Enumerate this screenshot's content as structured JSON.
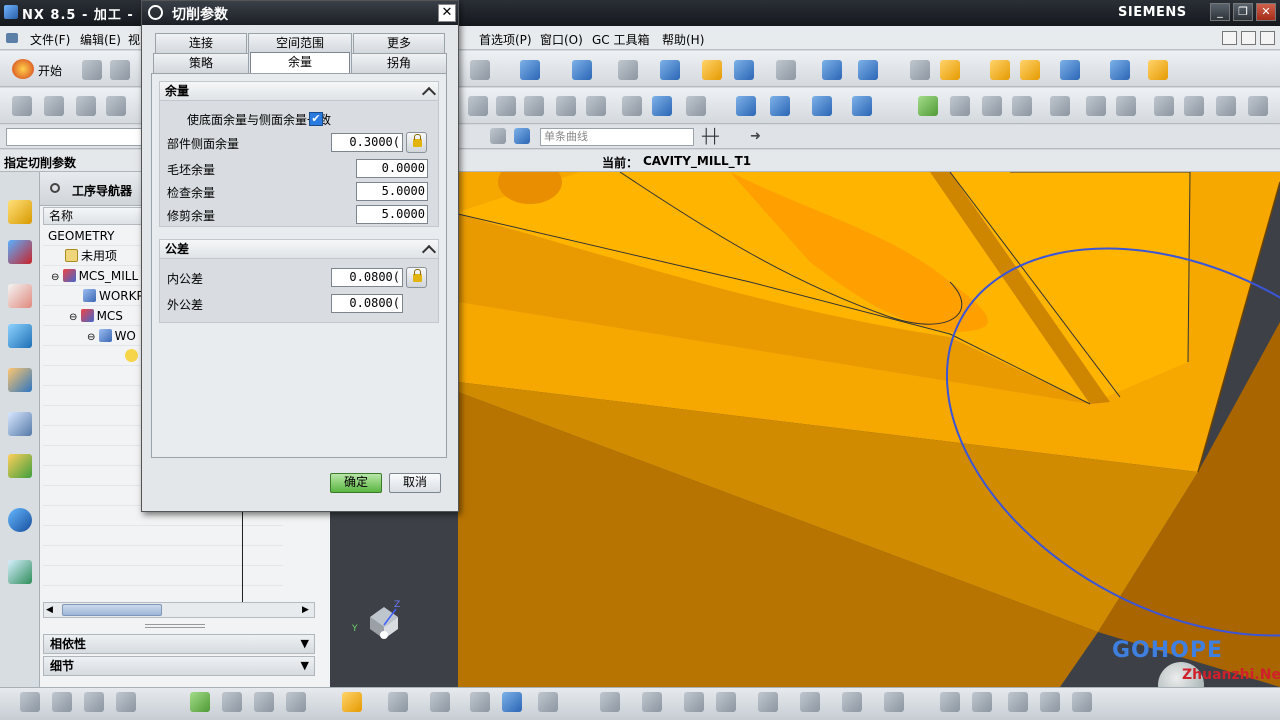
{
  "app": {
    "title": "NX 8.5 - 加工 -",
    "brand": "SIEMENS",
    "min": "_",
    "max": "❐",
    "close": "✕"
  },
  "menu": {
    "start_label": "开始",
    "items": [
      "文件(F)",
      "编辑(E)",
      "视",
      "首选项(P)",
      "窗口(O)",
      "GC 工具箱",
      "帮助(H)"
    ]
  },
  "selection_bar": {
    "filter_placeholder": "",
    "curve_rule": "单条曲线"
  },
  "cue": {
    "prompt": "指定切削参数",
    "current_label": "当前：",
    "current_op": "CAVITY_MILL_T1"
  },
  "navigator": {
    "title": "工序导航器",
    "column": "名称",
    "rows": [
      "GEOMETRY",
      "未用项",
      "MCS_MILL",
      "WORKP",
      "MCS",
      "WO"
    ],
    "sections": [
      "相依性",
      "细节"
    ]
  },
  "dialog": {
    "title": "切削参数",
    "tabs_top": [
      "连接",
      "空间范围",
      "更多"
    ],
    "tabs_bottom": [
      "策略",
      "余量",
      "拐角"
    ],
    "active_tab": "余量",
    "stock": {
      "heading": "余量",
      "checkbox_label": "使底面余量与侧面余量一致",
      "checked": true,
      "part_side_label": "部件侧面余量",
      "part_side_value": "0.3000(",
      "blank_label": "毛坯余量",
      "blank_value": "0.0000",
      "check_label": "检查余量",
      "check_value": "5.0000",
      "trim_label": "修剪余量",
      "trim_value": "5.0000"
    },
    "tolerance": {
      "heading": "公差",
      "intol_label": "内公差",
      "intol_value": "0.0800(",
      "outtol_label": "外公差",
      "outtol_value": "0.0800("
    },
    "ok": "确定",
    "cancel": "取消"
  },
  "watermark": {
    "line1": "GOHOPE",
    "line2": "Zhuanzhi.Net"
  },
  "colors": {
    "part_orange": "#f5a300",
    "part_dark": "#b06c00",
    "background": "#3d4147",
    "curve_blue": "#3a55d8"
  }
}
